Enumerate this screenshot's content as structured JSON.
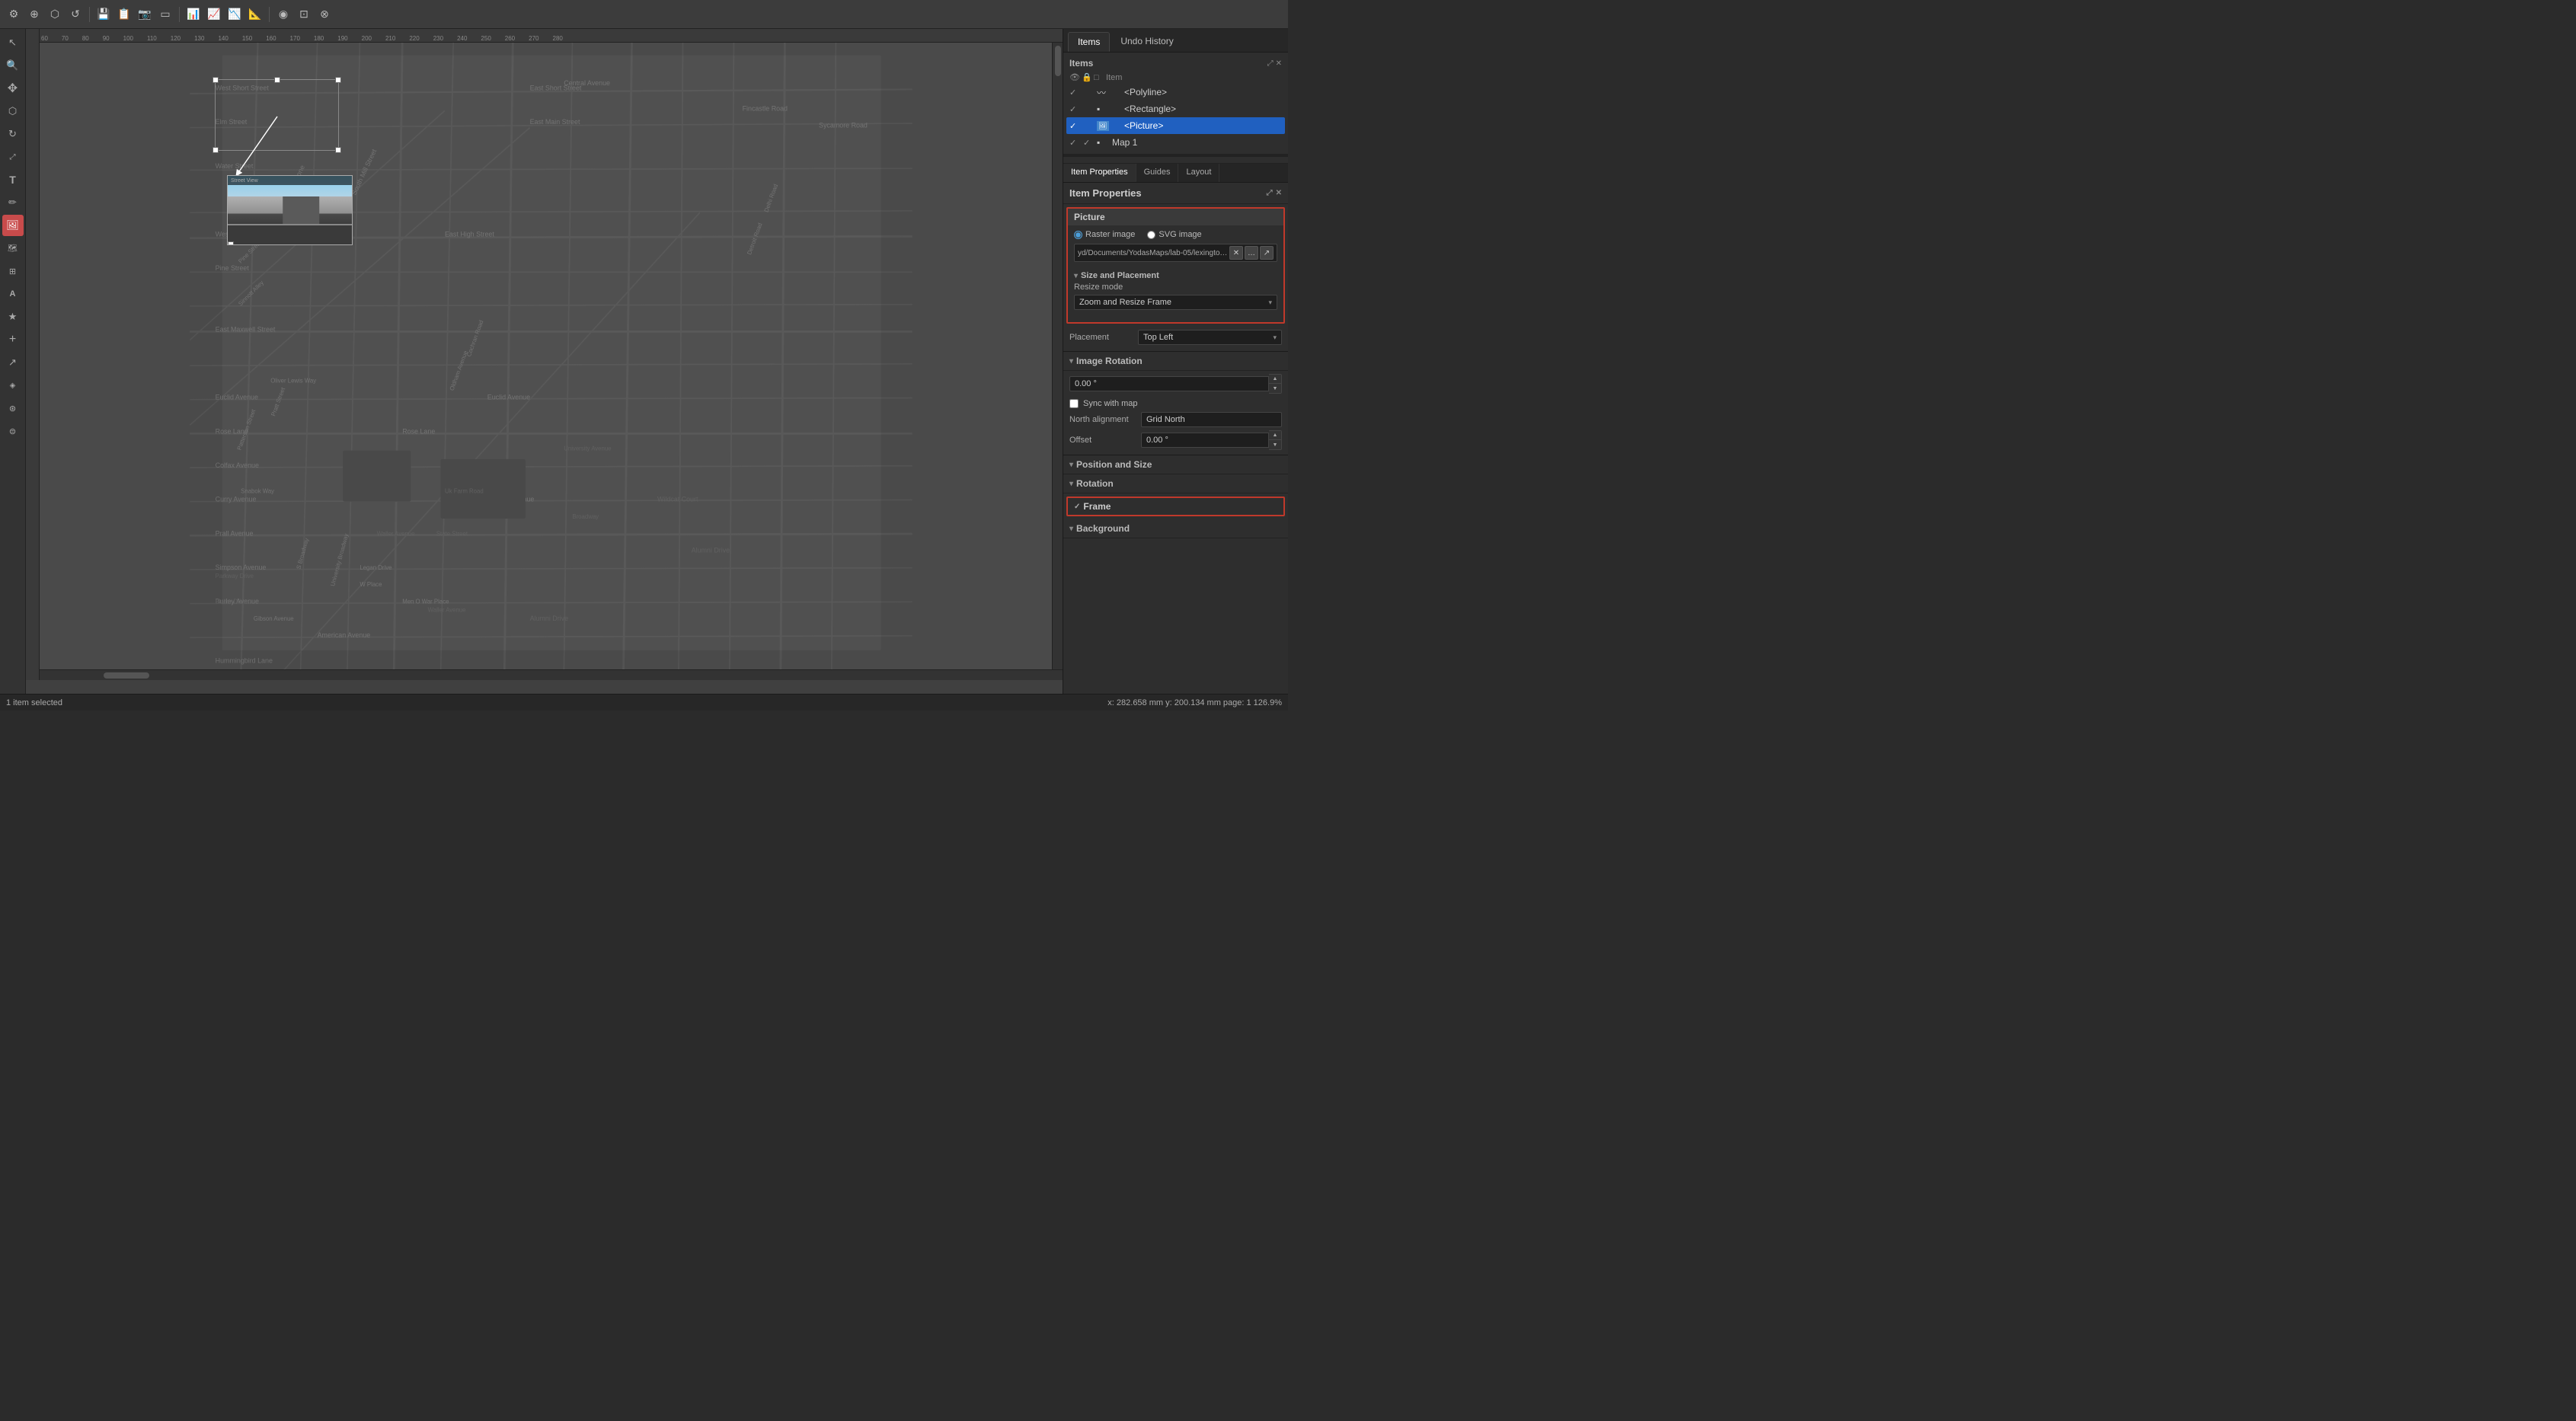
{
  "toolbar": {
    "icons": [
      "⚙",
      "🔍",
      "⬡",
      "↺",
      "💾",
      "📋",
      "📷",
      "🔲",
      "📊",
      "📈",
      "📉",
      "📐"
    ]
  },
  "left_tools": [
    {
      "icon": "↖",
      "name": "cursor-tool",
      "active": false
    },
    {
      "icon": "🔍",
      "name": "zoom-tool",
      "active": false
    },
    {
      "icon": "↕",
      "name": "pan-tool",
      "active": false
    },
    {
      "icon": "✏",
      "name": "edit-tool",
      "active": false
    },
    {
      "icon": "▱",
      "name": "shape-tool",
      "active": false
    },
    {
      "icon": "⬡",
      "name": "polygon-tool",
      "active": false
    },
    {
      "icon": "📐",
      "name": "measure-tool",
      "active": false
    },
    {
      "icon": "T",
      "name": "text-tool",
      "active": false
    },
    {
      "icon": "⊕",
      "name": "add-tool",
      "active": false
    },
    {
      "icon": "🖼",
      "name": "picture-tool",
      "active": true,
      "selected": true
    },
    {
      "icon": "A",
      "name": "font-tool",
      "active": false
    },
    {
      "icon": "⊞",
      "name": "grid-tool",
      "active": false
    },
    {
      "icon": "⊛",
      "name": "star-tool",
      "active": false
    },
    {
      "icon": "✚",
      "name": "plus-tool",
      "active": false
    },
    {
      "icon": "◈",
      "name": "special-tool",
      "active": false
    },
    {
      "icon": "⬡",
      "name": "hex-tool",
      "active": false
    },
    {
      "icon": "⬤",
      "name": "circle-tool",
      "active": false
    }
  ],
  "panel": {
    "tabs": [
      {
        "label": "Items",
        "active": true
      },
      {
        "label": "Undo History",
        "active": false
      }
    ],
    "items_label": "Items",
    "items": [
      {
        "name": "<Polyline>",
        "visible": true,
        "locked": false,
        "type": "polyline",
        "checked": true,
        "indent": 1
      },
      {
        "name": "<Rectangle>",
        "visible": true,
        "locked": false,
        "type": "rectangle",
        "checked": true,
        "indent": 1
      },
      {
        "name": "<Picture>",
        "visible": true,
        "locked": false,
        "type": "picture",
        "checked": true,
        "selected": true,
        "indent": 1
      },
      {
        "name": "Map 1",
        "visible": true,
        "locked": false,
        "type": "map",
        "checked": true,
        "indent": 0
      }
    ],
    "prop_tabs": [
      {
        "label": "Item Properties",
        "active": true
      },
      {
        "label": "Guides",
        "active": false
      },
      {
        "label": "Layout",
        "active": false
      }
    ],
    "item_properties_label": "Item Properties",
    "picture": {
      "section_title": "Picture",
      "raster_label": "Raster image",
      "svg_label": "SVG image",
      "file_path": "yd/Documents/YodasMaps/lab-05/lexington-main-street/pot.jpg",
      "size_and_placement_label": "Size and Placement",
      "resize_mode_label": "Resize mode",
      "resize_mode_value": "Zoom and Resize Frame",
      "placement_label": "Placement",
      "placement_value": "Top Left",
      "image_rotation_label": "Image Rotation",
      "rotation_value": "0.00 °",
      "sync_with_map_label": "Sync with map",
      "north_alignment_label": "North alignment",
      "north_alignment_value": "Grid North",
      "offset_label": "Offset",
      "offset_value": "0.00 °",
      "position_and_size_label": "Position and Size",
      "rotation_section_label": "Rotation",
      "frame_label": "Frame",
      "background_label": "Background"
    }
  },
  "status_bar": {
    "left": "1 item selected",
    "right": "x: 282.658 mm  y: 200.134 mm  page: 1       126.9%"
  },
  "ruler": {
    "ticks": [
      "60",
      "70",
      "80",
      "90",
      "100",
      "110",
      "120",
      "130",
      "140",
      "150",
      "160",
      "170",
      "180",
      "190",
      "200",
      "210",
      "220",
      "230",
      "240",
      "250",
      "260",
      "270",
      "280"
    ]
  }
}
